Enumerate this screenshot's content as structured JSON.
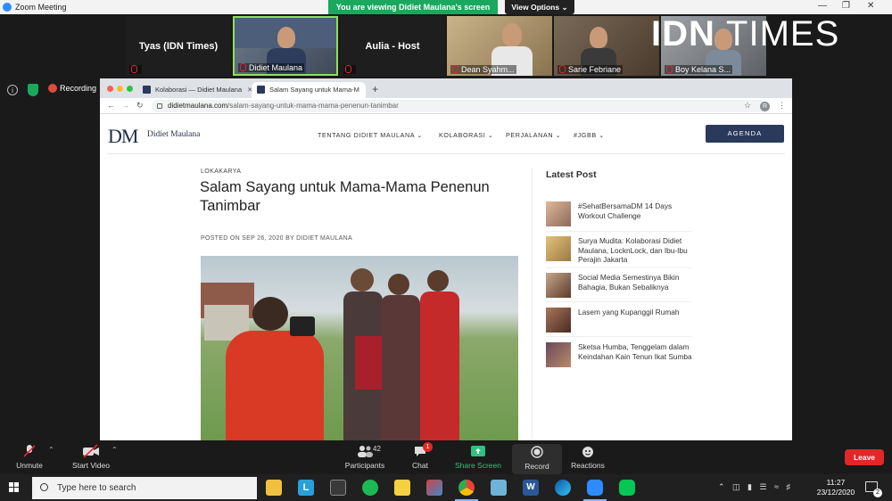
{
  "zoom": {
    "window_title": "Zoom Meeting",
    "viewing_banner": "You are viewing Didiet Maulana's screen",
    "view_options": "View Options ⌄",
    "recording_label": "Recording",
    "participants": [
      {
        "name": "Tyas (IDN Times)",
        "type": "name-only"
      },
      {
        "name": "Didiet Maulana",
        "type": "video"
      },
      {
        "name": "Aulia - Host",
        "type": "name-only"
      },
      {
        "name": "Dean Syahm...",
        "type": "video"
      },
      {
        "name": "Sarie Febriane",
        "type": "video"
      },
      {
        "name": "Boy Kelana S...",
        "type": "video"
      }
    ],
    "brand_overlay": {
      "bold": "IDN",
      "thin": "TIMES"
    },
    "controls": {
      "unmute": "Unmute",
      "start_video": "Start Video",
      "participants": "Participants",
      "participants_count": "42",
      "chat": "Chat",
      "chat_badge": "1",
      "share_screen": "Share Screen",
      "record": "Record",
      "reactions": "Reactions",
      "leave": "Leave"
    }
  },
  "browser": {
    "tabs": [
      {
        "title": "Kolaborasi — Didiet Maulana",
        "active": false
      },
      {
        "title": "Salam Sayang untuk Mama-M",
        "active": true
      }
    ],
    "url_host": "didietmaulana.com",
    "url_path": "/salam-sayang-untuk-mama-mama-penenun-tanimbar",
    "profile_initial": "R"
  },
  "site": {
    "logo": "DM",
    "brand_name": "Didiet Maulana",
    "menu": [
      "TENTANG DIDIET MAULANA ⌄",
      "KOLABORASI ⌄",
      "PERJALANAN ⌄",
      "#JGBB ⌄"
    ],
    "agenda_button": "AGENDA",
    "post": {
      "category": "LOKAKARYA",
      "title": "Salam Sayang untuk Mama-Mama Penenun Tanimbar",
      "meta": "POSTED ON SEP 26, 2020 BY DIDIET MAULANA"
    },
    "sidebar": {
      "heading": "Latest Post",
      "posts": [
        "#SehatBersamaDM 14 Days Workout Challenge",
        "Surya Mudita: Kolaborasi Didiet Maulana, LocknLock, dan Ibu-Ibu Perajin Jakarta",
        "Social Media Semestinya Bikin Bahagia, Bukan Sebaliknya",
        "Lasem yang Kupanggil Rumah",
        "Sketsa Humba, Tenggelam dalam Keindahan Kain Tenun Ikat Sumba"
      ]
    }
  },
  "taskbar": {
    "search_placeholder": "Type here to search",
    "time": "11:27",
    "date": "23/12/2020",
    "notification_count": "2"
  }
}
